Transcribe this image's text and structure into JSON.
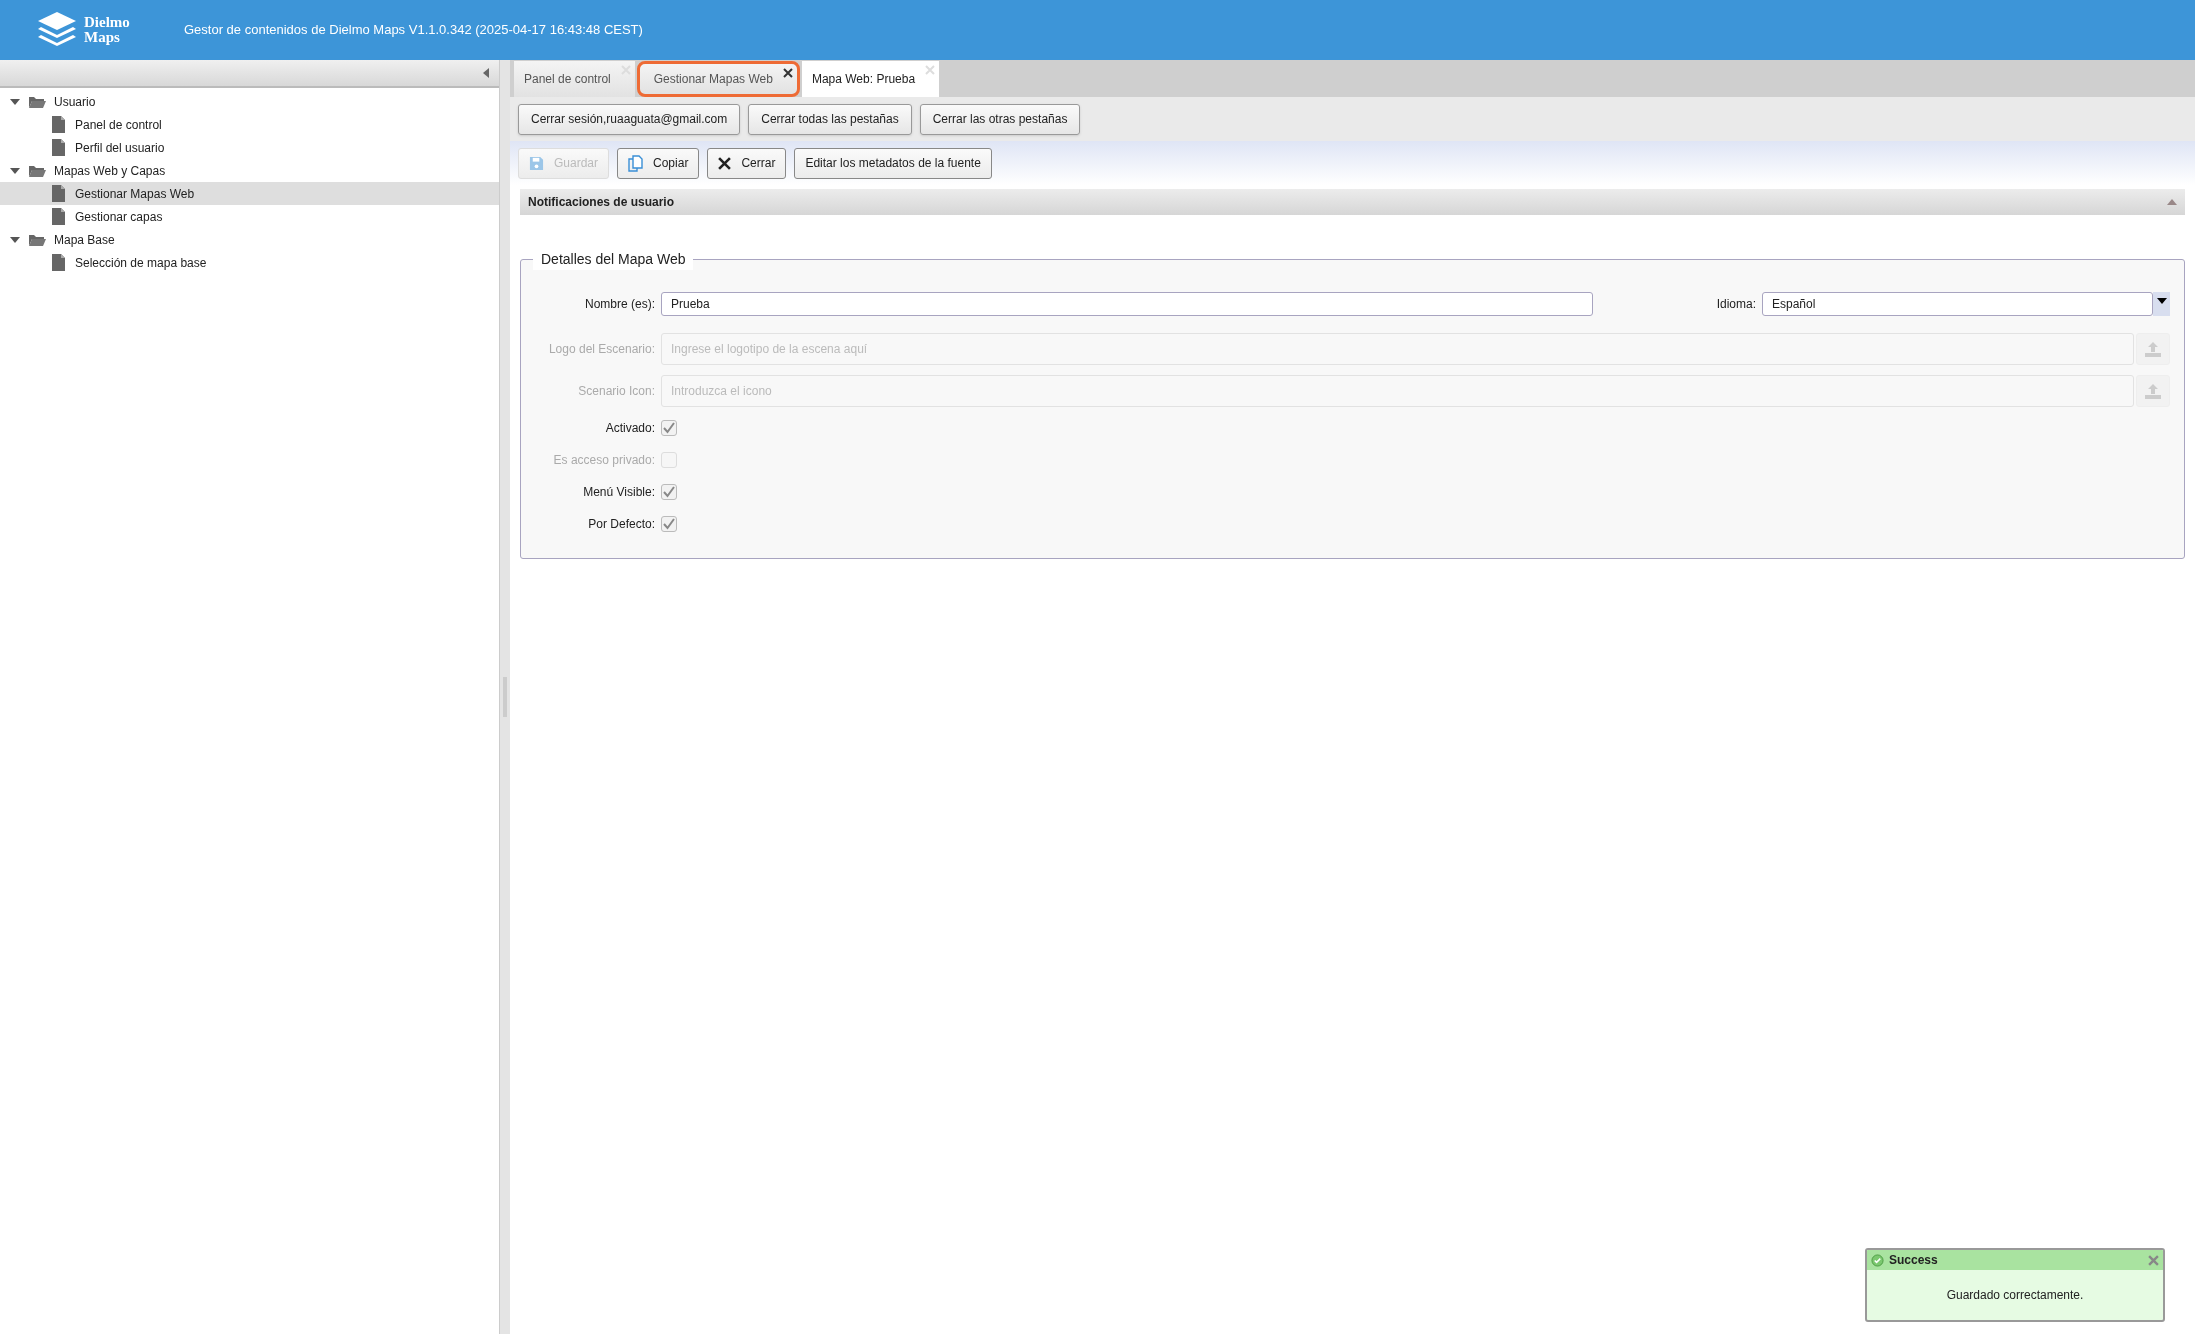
{
  "header": {
    "logo_text": "Dielmo Maps",
    "title": "Gestor de contenidos de Dielmo Maps V1.1.0.342 (2025-04-17 16:43:48 CEST)"
  },
  "sidebar": {
    "tree": [
      {
        "label": "Usuario",
        "expanded": true,
        "children": [
          {
            "label": "Panel de control",
            "selected": false
          },
          {
            "label": "Perfil del usuario",
            "selected": false
          }
        ]
      },
      {
        "label": "Mapas Web y Capas",
        "expanded": true,
        "children": [
          {
            "label": "Gestionar Mapas Web",
            "selected": true
          },
          {
            "label": "Gestionar capas",
            "selected": false
          }
        ]
      },
      {
        "label": "Mapa Base",
        "expanded": true,
        "children": [
          {
            "label": "Selección de mapa base",
            "selected": false
          }
        ]
      }
    ]
  },
  "tabs": [
    {
      "label": "Panel de control",
      "selected": false,
      "highlighted": false
    },
    {
      "label": "Gestionar Mapas Web",
      "selected": false,
      "highlighted": true
    },
    {
      "label": "Mapa Web: Prueba",
      "selected": true,
      "highlighted": false
    }
  ],
  "session_buttons": [
    "Cerrar sesión,ruaaguata@gmail.com",
    "Cerrar todas las pestañas",
    "Cerrar las otras pestañas"
  ],
  "toolbar": [
    {
      "label": "Guardar",
      "disabled": true
    },
    {
      "label": "Copiar",
      "disabled": false
    },
    {
      "label": "Cerrar",
      "disabled": false
    },
    {
      "label": "Editar los metadatos de la fuente",
      "disabled": false
    }
  ],
  "notifications_panel": {
    "title": "Notificaciones de usuario",
    "expanded": true
  },
  "form": {
    "legend": "Detalles del Mapa Web",
    "name_field": {
      "label": "Nombre (es):",
      "value": "Prueba"
    },
    "language_field": {
      "label": "Idioma:",
      "value": "Español"
    },
    "rows": [
      {
        "kind": "upload",
        "label": "Logo del Escenario:",
        "placeholder": "Ingrese el logotipo de la escena aquí",
        "disabled": true
      },
      {
        "kind": "upload",
        "label": "Scenario Icon:",
        "placeholder": "Introduzca el icono",
        "disabled": true
      },
      {
        "kind": "checkbox",
        "label": "Activado:",
        "checked": true,
        "disabled": false
      },
      {
        "kind": "checkbox",
        "label": "Es acceso privado:",
        "checked": false,
        "disabled": true
      },
      {
        "kind": "checkbox",
        "label": "Menú Visible:",
        "checked": true,
        "disabled": false
      },
      {
        "kind": "checkbox",
        "label": "Por Defecto:",
        "checked": true,
        "disabled": false
      }
    ]
  },
  "toast": {
    "title": "Success",
    "message": "Guardado correctamente."
  }
}
